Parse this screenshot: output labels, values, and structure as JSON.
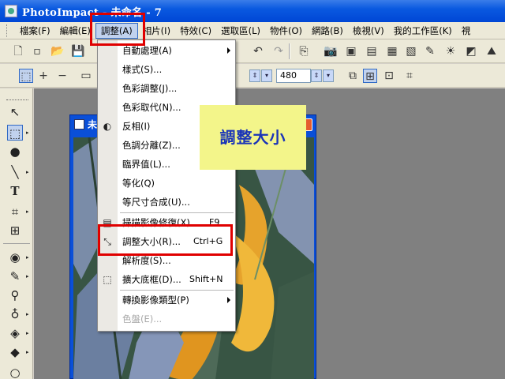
{
  "window": {
    "title": "PhotoImpact - 未命名 - 7"
  },
  "menubar": {
    "items": [
      {
        "label": "檔案(F)"
      },
      {
        "label": "編輯(E)"
      },
      {
        "label": "調整(A)"
      },
      {
        "label": "相片(I)"
      },
      {
        "label": "特效(C)"
      },
      {
        "label": "選取區(L)"
      },
      {
        "label": "物件(O)"
      },
      {
        "label": "網路(B)"
      },
      {
        "label": "檢視(V)"
      },
      {
        "label": "我的工作區(K)"
      },
      {
        "label": "視"
      }
    ]
  },
  "toolbar": {
    "height_value": "480"
  },
  "document": {
    "title": "未"
  },
  "adjust_menu": {
    "items": [
      {
        "label": "自動處理(A)",
        "shortcut": "",
        "submenu": true,
        "icon": ""
      },
      {
        "label": "樣式(S)...",
        "shortcut": "",
        "submenu": false,
        "icon": ""
      },
      {
        "label": "色彩調整(J)...",
        "shortcut": "",
        "submenu": false,
        "icon": ""
      },
      {
        "label": "色彩取代(N)...",
        "shortcut": "",
        "submenu": false,
        "icon": ""
      },
      {
        "label": "反相(I)",
        "shortcut": "",
        "submenu": false,
        "icon": "invert-icon"
      },
      {
        "label": "色調分離(Z)...",
        "shortcut": "",
        "submenu": false,
        "icon": ""
      },
      {
        "label": "臨界值(L)...",
        "shortcut": "",
        "submenu": false,
        "icon": ""
      },
      {
        "label": "等化(Q)",
        "shortcut": "",
        "submenu": false,
        "icon": ""
      },
      {
        "label": "等尺寸合成(U)...",
        "shortcut": "",
        "submenu": false,
        "icon": ""
      },
      {
        "label": "掃描影像修復(X)...",
        "shortcut": "F9",
        "submenu": false,
        "icon": "scan-icon"
      },
      {
        "label": "調整大小(R)...",
        "shortcut": "Ctrl+G",
        "submenu": false,
        "icon": "resize-icon"
      },
      {
        "label": "解析度(S)...",
        "shortcut": "",
        "submenu": false,
        "icon": ""
      },
      {
        "label": "擴大底框(D)...",
        "shortcut": "Shift+N",
        "submenu": false,
        "icon": "expand-canvas-icon"
      },
      {
        "label": "轉換影像類型(P)",
        "shortcut": "",
        "submenu": true,
        "icon": ""
      },
      {
        "label": "色盤(E)...",
        "shortcut": "",
        "submenu": false,
        "disabled": true,
        "icon": ""
      }
    ]
  },
  "callout": {
    "text": "調整大小"
  },
  "colors": {
    "title_blue": "#0a59e0",
    "highlight_red": "#e00000",
    "callout_bg": "#f3f58a",
    "callout_text": "#1a34b8"
  }
}
